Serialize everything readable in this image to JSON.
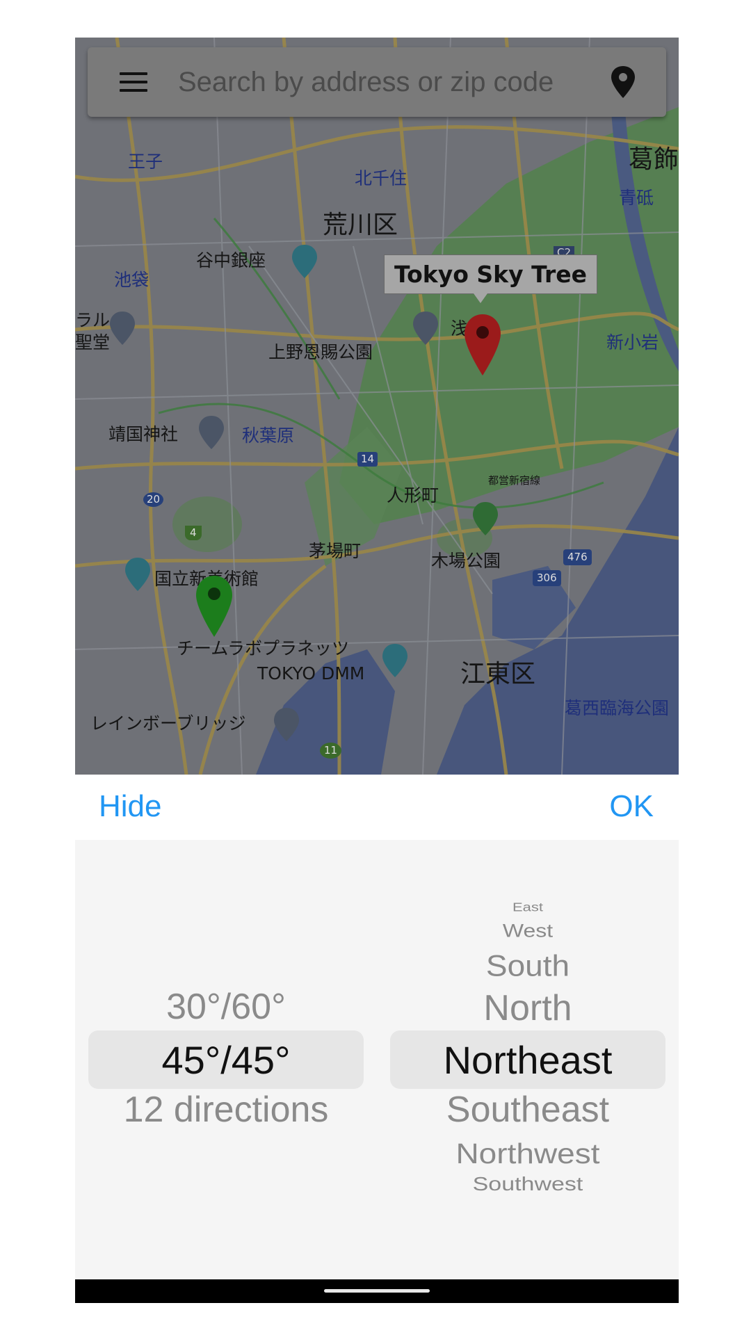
{
  "search": {
    "placeholder": "Search by address or zip code"
  },
  "map": {
    "tooltip": "Tokyo Sky Tree",
    "labels": {
      "arakawa": "荒川区",
      "yanaka": "谷中銀座",
      "oji": "王子",
      "kitasenju": "北千住",
      "katsushika": "葛飾",
      "aoto": "青砥",
      "ikebukuro": "池袋",
      "lal": "ラル",
      "seidou": "聖堂",
      "ueno": "上野恩賜公園",
      "asakusa": "浅",
      "shinkoiwa": "新小岩",
      "yasukuni": "靖国神社",
      "akihabara": "秋葉原",
      "ningyocho": "人形町",
      "toeishinjuku": "都営新宿線",
      "kayabacho": "茅場町",
      "kiba": "木場公園",
      "kokuritsu": "国立新美術館",
      "teamlab": "チームラボプラネッツ",
      "tokyodmm": "TOKYO DMM",
      "koto": "江東区",
      "kasai": "葛西臨海公園",
      "rainbow": "レインボーブリッジ",
      "r14": "14",
      "r20": "20",
      "r4": "4",
      "r476": "476",
      "r306": "306",
      "r11": "11",
      "rc2": "C2"
    },
    "colors": {
      "land": "#6f7177",
      "park": "#4f7a4a",
      "water": "#46557a",
      "road": "#a08a4a",
      "red_marker": "#9b1b1b",
      "green_marker": "#1c7d1c"
    }
  },
  "toolbar": {
    "hide_label": "Hide",
    "ok_label": "OK"
  },
  "picker": {
    "left": {
      "items": [
        "30°/60°",
        "45°/45°",
        "12 directions"
      ],
      "selected": "45°/45°"
    },
    "right": {
      "items": [
        "East",
        "West",
        "South",
        "North",
        "Northeast",
        "Southeast",
        "Northwest",
        "Southwest"
      ],
      "selected": "Northeast"
    }
  }
}
